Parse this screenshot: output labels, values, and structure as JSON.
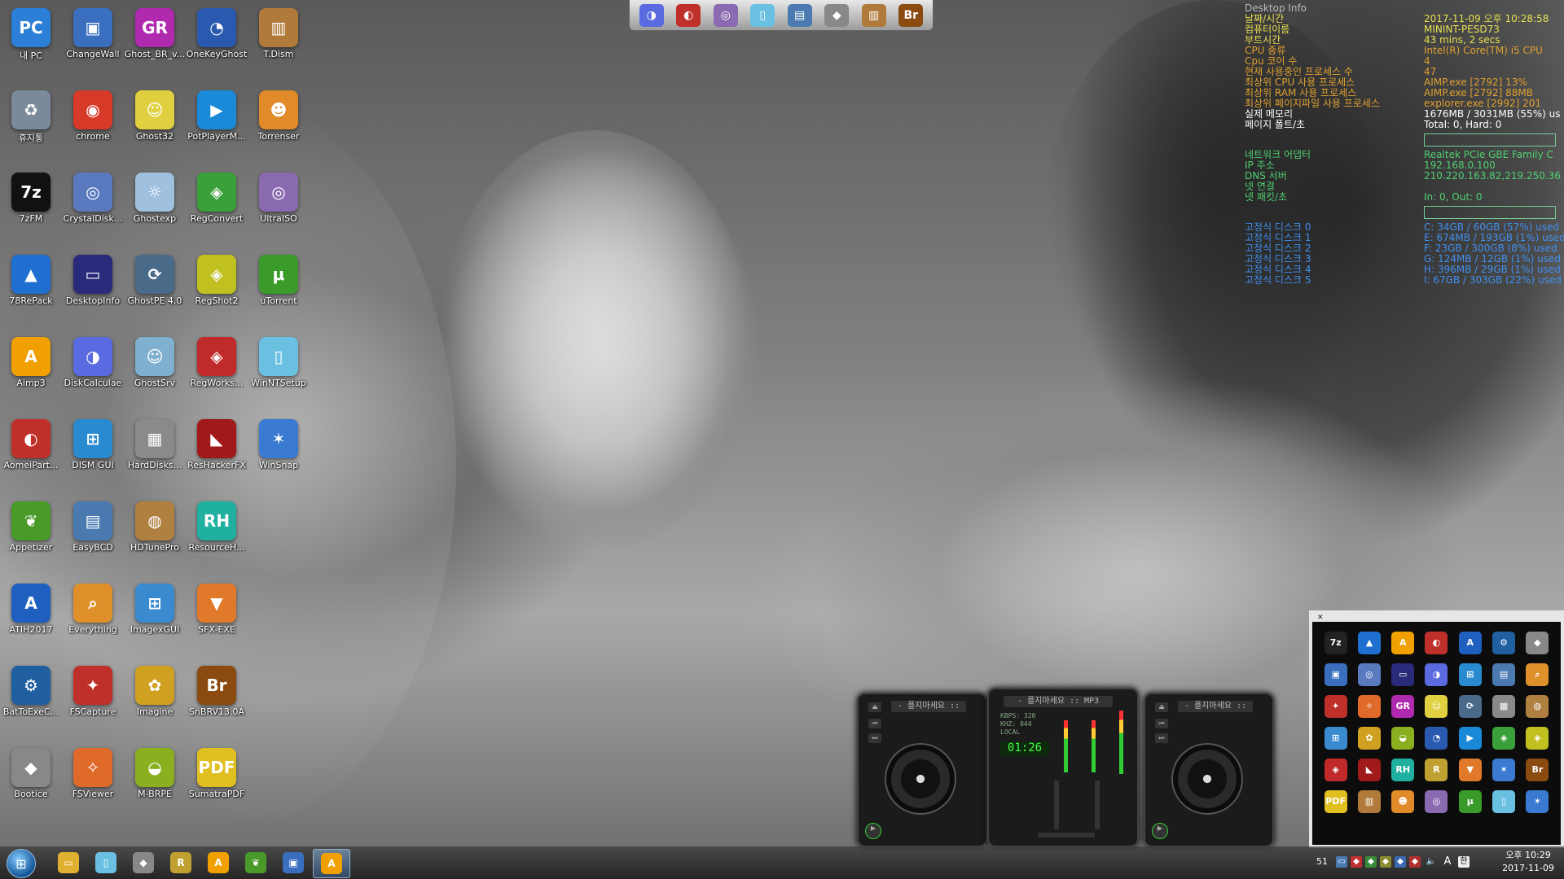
{
  "desktop": {
    "icons": [
      {
        "label": "내 PC",
        "glyph": "PC",
        "color": "#2b7fd6"
      },
      {
        "label": "휴지통",
        "glyph": "♻",
        "color": "#7a8a9a"
      },
      {
        "label": "7zFM",
        "glyph": "7z",
        "color": "#111111"
      },
      {
        "label": "78RePack",
        "glyph": "▲",
        "color": "#1f6fd0"
      },
      {
        "label": "Aimp3",
        "glyph": "A",
        "color": "#f0a000"
      },
      {
        "label": "AomeiPart...",
        "glyph": "◐",
        "color": "#c0302a"
      },
      {
        "label": "Appetizer",
        "glyph": "❦",
        "color": "#4a9a2a"
      },
      {
        "label": "ATIH2017",
        "glyph": "A",
        "color": "#1e5fbf"
      },
      {
        "label": "BatToExeC...",
        "glyph": "⚙",
        "color": "#2060a0"
      },
      {
        "label": "Bootice",
        "glyph": "◆",
        "color": "#888888"
      },
      {
        "label": "ChangeWall",
        "glyph": "▣",
        "color": "#3a6fc0"
      },
      {
        "label": "chrome",
        "glyph": "◉",
        "color": "#d83a2a"
      },
      {
        "label": "CrystalDisk...",
        "glyph": "◎",
        "color": "#5a7ac0"
      },
      {
        "label": "DesktopInfo",
        "glyph": "▭",
        "color": "#2a2a7a"
      },
      {
        "label": "DiskCalculae",
        "glyph": "◑",
        "color": "#5a6ae0"
      },
      {
        "label": "DISM GUI",
        "glyph": "⊞",
        "color": "#2a8ad0"
      },
      {
        "label": "EasyBCD",
        "glyph": "▤",
        "color": "#4a7ab0"
      },
      {
        "label": "Everything",
        "glyph": "⌕",
        "color": "#e0902a"
      },
      {
        "label": "FSCapture",
        "glyph": "✦",
        "color": "#c0302a"
      },
      {
        "label": "FSViewer",
        "glyph": "✧",
        "color": "#e06a2a"
      },
      {
        "label": "Ghost_BR_v...",
        "glyph": "GR",
        "color": "#b02ab0"
      },
      {
        "label": "Ghost32",
        "glyph": "☺",
        "color": "#e0d040"
      },
      {
        "label": "Ghostexp",
        "glyph": "☼",
        "color": "#a0c0e0"
      },
      {
        "label": "GhostPE 4.0",
        "glyph": "⟳",
        "color": "#4a6a8a"
      },
      {
        "label": "GhostSrv",
        "glyph": "☺",
        "color": "#80b0d0"
      },
      {
        "label": "HardDisks...",
        "glyph": "▦",
        "color": "#8a8a8a"
      },
      {
        "label": "HDTunePro",
        "glyph": "◍",
        "color": "#b08040"
      },
      {
        "label": "ImagexGUI",
        "glyph": "⊞",
        "color": "#3a8ad0"
      },
      {
        "label": "Imagine",
        "glyph": "✿",
        "color": "#d0a020"
      },
      {
        "label": "M-BRPE",
        "glyph": "◒",
        "color": "#8ab020"
      },
      {
        "label": "OneKeyGhost",
        "glyph": "◔",
        "color": "#2a5ab0"
      },
      {
        "label": "PotPlayerM...",
        "glyph": "▶",
        "color": "#1a8ad8"
      },
      {
        "label": "RegConvert",
        "glyph": "◈",
        "color": "#3aa03a"
      },
      {
        "label": "RegShot2",
        "glyph": "◈",
        "color": "#c0c020"
      },
      {
        "label": "RegWorks...",
        "glyph": "◈",
        "color": "#c02a2a"
      },
      {
        "label": "ResHackerFX",
        "glyph": "◣",
        "color": "#a01a1a"
      },
      {
        "label": "ResourceH...",
        "glyph": "RH",
        "color": "#20b0a0"
      },
      {
        "label": "SFX-EXE",
        "glyph": "▼",
        "color": "#e07a2a"
      },
      {
        "label": "SnBRV13.0A",
        "glyph": "Br",
        "color": "#8a4a10"
      },
      {
        "label": "SumatraPDF",
        "glyph": "PDF",
        "color": "#e0c020"
      },
      {
        "label": "T.Dism",
        "glyph": "▥",
        "color": "#b07a3a"
      },
      {
        "label": "Torrenser",
        "glyph": "☻",
        "color": "#e08a2a"
      },
      {
        "label": "UltraISO",
        "glyph": "◎",
        "color": "#8a6ab0"
      },
      {
        "label": "uTorrent",
        "glyph": "μ",
        "color": "#3a9a2a"
      },
      {
        "label": "WinNTSetup",
        "glyph": "▯",
        "color": "#6ac0e0"
      },
      {
        "label": "WinSnap",
        "glyph": "✶",
        "color": "#3a7ad0"
      }
    ]
  },
  "top_dock": {
    "items": [
      {
        "name": "diskcalc-icon",
        "color": "#5a6ae0",
        "glyph": "◑"
      },
      {
        "name": "aomei-icon",
        "color": "#c0302a",
        "glyph": "◐"
      },
      {
        "name": "ultraiso-icon",
        "color": "#8a6ab0",
        "glyph": "◎"
      },
      {
        "name": "winntsetup-icon",
        "color": "#6ac0e0",
        "glyph": "▯"
      },
      {
        "name": "easybcd-icon",
        "color": "#4a7ab0",
        "glyph": "▤"
      },
      {
        "name": "bootice-icon",
        "color": "#888888",
        "glyph": "◆"
      },
      {
        "name": "tdism-icon",
        "color": "#b07a3a",
        "glyph": "▥"
      },
      {
        "name": "snbr-icon",
        "color": "#8a4a10",
        "glyph": "Br"
      }
    ]
  },
  "desktop_info": {
    "title": "Desktop Info",
    "rows": [
      {
        "k": "날짜/시간",
        "v": "2017-11-09 오후 10:28:58",
        "kc": "#e8e050",
        "vc": "#e8e050"
      },
      {
        "k": "컴퓨터이름",
        "v": "MININT-PESD73",
        "kc": "#e8e050",
        "vc": "#e8e050"
      },
      {
        "k": "부트시간",
        "v": "43 mins, 2 secs",
        "kc": "#e8e050",
        "vc": "#e8e050"
      },
      {
        "k": "CPU 종류",
        "v": "Intel(R) Core(TM) i5 CPU",
        "kc": "#e0a030",
        "vc": "#e0a030"
      },
      {
        "k": "Cpu 코어 수",
        "v": "4",
        "kc": "#e0a030",
        "vc": "#e0a030"
      },
      {
        "k": "현재 사용중인 프로세스 수",
        "v": "47",
        "kc": "#e0a030",
        "vc": "#e0a030"
      },
      {
        "k": "최상위 CPU 사용 프로세스",
        "v": "AIMP.exe [2792] 13%",
        "kc": "#e0a030",
        "vc": "#e0a030"
      },
      {
        "k": "최상위 RAM 사용 프로세스",
        "v": "AIMP.exe [2792] 88MB",
        "kc": "#e0a030",
        "vc": "#e0a030"
      },
      {
        "k": "최상위 페이지파일 사용 프로세스",
        "v": "explorer.exe [2992] 201",
        "kc": "#e0a030",
        "vc": "#e0a030"
      },
      {
        "k": "실제 메모리",
        "v": "1676MB / 3031MB (55%) us",
        "kc": "#ffffff",
        "vc": "#ffffff"
      },
      {
        "k": "페이지 폴트/초",
        "v": "Total: 0, Hard: 0",
        "kc": "#ffffff",
        "vc": "#ffffff"
      }
    ],
    "net_rows": [
      {
        "k": "네트워크 어댑터",
        "v": "Realtek PCIe GBE Family C",
        "kc": "#50d070",
        "vc": "#50d070"
      },
      {
        "k": "IP 주소",
        "v": "192.168.0.100",
        "kc": "#50d070",
        "vc": "#50d070"
      },
      {
        "k": "DNS 서버",
        "v": "210.220.163.82,219.250.36",
        "kc": "#50d070",
        "vc": "#50d070"
      },
      {
        "k": "넷 연결",
        "v": "",
        "kc": "#50d070",
        "vc": "#50d070"
      },
      {
        "k": "넷 패킷/초",
        "v": "In: 0, Out: 0",
        "kc": "#50d070",
        "vc": "#50d070"
      }
    ],
    "disk_rows": [
      {
        "k": "고정식 디스크 0",
        "v": "C: 34GB / 60GB (57%) used",
        "kc": "#4090f0",
        "vc": "#4090f0"
      },
      {
        "k": "고정식 디스크 1",
        "v": "E: 674MB / 193GB (1%) used",
        "kc": "#4090f0",
        "vc": "#4090f0"
      },
      {
        "k": "고정식 디스크 2",
        "v": "F: 23GB / 300GB (8%) used",
        "kc": "#4090f0",
        "vc": "#4090f0"
      },
      {
        "k": "고정식 디스크 3",
        "v": "G: 124MB / 12GB (1%) used",
        "kc": "#4090f0",
        "vc": "#4090f0"
      },
      {
        "k": "고정식 디스크 4",
        "v": "H: 396MB / 29GB (1%) used",
        "kc": "#4090f0",
        "vc": "#4090f0"
      },
      {
        "k": "고정식 디스크 5",
        "v": "I: 67GB / 303GB (22%) used",
        "kc": "#4090f0",
        "vc": "#4090f0"
      }
    ]
  },
  "dj": {
    "left_title": "- 플지마세요 ::",
    "mid_title": "- 플지마세요 :: MP3",
    "right_title": "- 플지마세요 ::",
    "time": "01:26",
    "kbps_label": "KBPS:",
    "kbps": "320",
    "khz_label": "KHZ:",
    "khz": "044",
    "local": "LOCAL"
  },
  "launcher": {
    "items": [
      {
        "name": "7zfm-icon",
        "glyph": "7z",
        "color": "#222"
      },
      {
        "name": "repack-icon",
        "glyph": "▲",
        "color": "#1f6fd0"
      },
      {
        "name": "aimp-icon",
        "glyph": "A",
        "color": "#f0a000"
      },
      {
        "name": "aomei-icon",
        "glyph": "◐",
        "color": "#c0302a"
      },
      {
        "name": "atih-icon",
        "glyph": "A",
        "color": "#1e5fbf"
      },
      {
        "name": "battoexe-icon",
        "glyph": "⚙",
        "color": "#2060a0"
      },
      {
        "name": "bootice-icon",
        "glyph": "◆",
        "color": "#888"
      },
      {
        "name": "changewall-icon",
        "glyph": "▣",
        "color": "#3a6fc0"
      },
      {
        "name": "crystaldisk-icon",
        "glyph": "◎",
        "color": "#5a7ac0"
      },
      {
        "name": "desktopinfo-icon",
        "glyph": "▭",
        "color": "#2a2a7a"
      },
      {
        "name": "diskcalc-icon",
        "glyph": "◑",
        "color": "#5a6ae0"
      },
      {
        "name": "dismgui-icon",
        "glyph": "⊞",
        "color": "#2a8ad0"
      },
      {
        "name": "easybcd-icon",
        "glyph": "▤",
        "color": "#4a7ab0"
      },
      {
        "name": "everything-icon",
        "glyph": "⌕",
        "color": "#e0902a"
      },
      {
        "name": "fscapture-icon",
        "glyph": "✦",
        "color": "#c0302a"
      },
      {
        "name": "fsviewer-icon",
        "glyph": "✧",
        "color": "#e06a2a"
      },
      {
        "name": "ghostbr-icon",
        "glyph": "GR",
        "color": "#b02ab0"
      },
      {
        "name": "ghost32-icon",
        "glyph": "☺",
        "color": "#e0d040"
      },
      {
        "name": "ghostpe-icon",
        "glyph": "⟳",
        "color": "#4a6a8a"
      },
      {
        "name": "harddisks-icon",
        "glyph": "▦",
        "color": "#8a8a8a"
      },
      {
        "name": "hdtune-icon",
        "glyph": "◍",
        "color": "#b08040"
      },
      {
        "name": "imagexgui-icon",
        "glyph": "⊞",
        "color": "#3a8ad0"
      },
      {
        "name": "imagine-icon",
        "glyph": "✿",
        "color": "#d0a020"
      },
      {
        "name": "mbrpe-icon",
        "glyph": "◒",
        "color": "#8ab020"
      },
      {
        "name": "onekeyghost-icon",
        "glyph": "◔",
        "color": "#2a5ab0"
      },
      {
        "name": "potplayer-icon",
        "glyph": "▶",
        "color": "#1a8ad8"
      },
      {
        "name": "regconvert-icon",
        "glyph": "◈",
        "color": "#3aa03a"
      },
      {
        "name": "regshot-icon",
        "glyph": "◈",
        "color": "#c0c020"
      },
      {
        "name": "regworks-icon",
        "glyph": "◈",
        "color": "#c02a2a"
      },
      {
        "name": "reshacker-icon",
        "glyph": "◣",
        "color": "#a01a1a"
      },
      {
        "name": "resourceh-icon",
        "glyph": "RH",
        "color": "#20b0a0"
      },
      {
        "name": "r-icon",
        "glyph": "R",
        "color": "#c0a030"
      },
      {
        "name": "sfxexe-icon",
        "glyph": "▼",
        "color": "#e07a2a"
      },
      {
        "name": "snap-icon",
        "glyph": "✶",
        "color": "#3a7ad0"
      },
      {
        "name": "snbr-icon",
        "glyph": "Br",
        "color": "#8a4a10"
      },
      {
        "name": "sumatra-icon",
        "glyph": "PDF",
        "color": "#e0c020"
      },
      {
        "name": "tdism-icon",
        "glyph": "▥",
        "color": "#b07a3a"
      },
      {
        "name": "torrenser-icon",
        "glyph": "☻",
        "color": "#e08a2a"
      },
      {
        "name": "ultraiso-icon",
        "glyph": "◎",
        "color": "#8a6ab0"
      },
      {
        "name": "utorrent-icon",
        "glyph": "μ",
        "color": "#3a9a2a"
      },
      {
        "name": "winntsetup-icon",
        "glyph": "▯",
        "color": "#6ac0e0"
      },
      {
        "name": "winsnap-icon",
        "glyph": "✶",
        "color": "#3a7ad0"
      }
    ]
  },
  "taskbar": {
    "start_glyph": "⊞",
    "items": [
      {
        "name": "explorer-icon",
        "glyph": "▭",
        "color": "#e0b030",
        "active": false
      },
      {
        "name": "winntsetup-icon",
        "glyph": "▯",
        "color": "#6ac0e0",
        "active": false
      },
      {
        "name": "bootice-icon",
        "glyph": "◆",
        "color": "#888",
        "active": false
      },
      {
        "name": "r-icon",
        "glyph": "R",
        "color": "#c0a030",
        "active": false
      },
      {
        "name": "aimp-icon",
        "glyph": "A",
        "color": "#f0a000",
        "active": false
      },
      {
        "name": "appetizer-icon",
        "glyph": "❦",
        "color": "#4a9a2a",
        "active": false
      },
      {
        "name": "changewall-icon",
        "glyph": "▣",
        "color": "#3a6fc0",
        "active": false
      },
      {
        "name": "aimp-active-icon",
        "glyph": "A",
        "color": "#f0a000",
        "active": true
      }
    ],
    "tray_lang": "A",
    "tray_ime": "한",
    "tray_num": "51",
    "clock_time": "오후 10:29",
    "clock_date": "2017-11-09"
  }
}
